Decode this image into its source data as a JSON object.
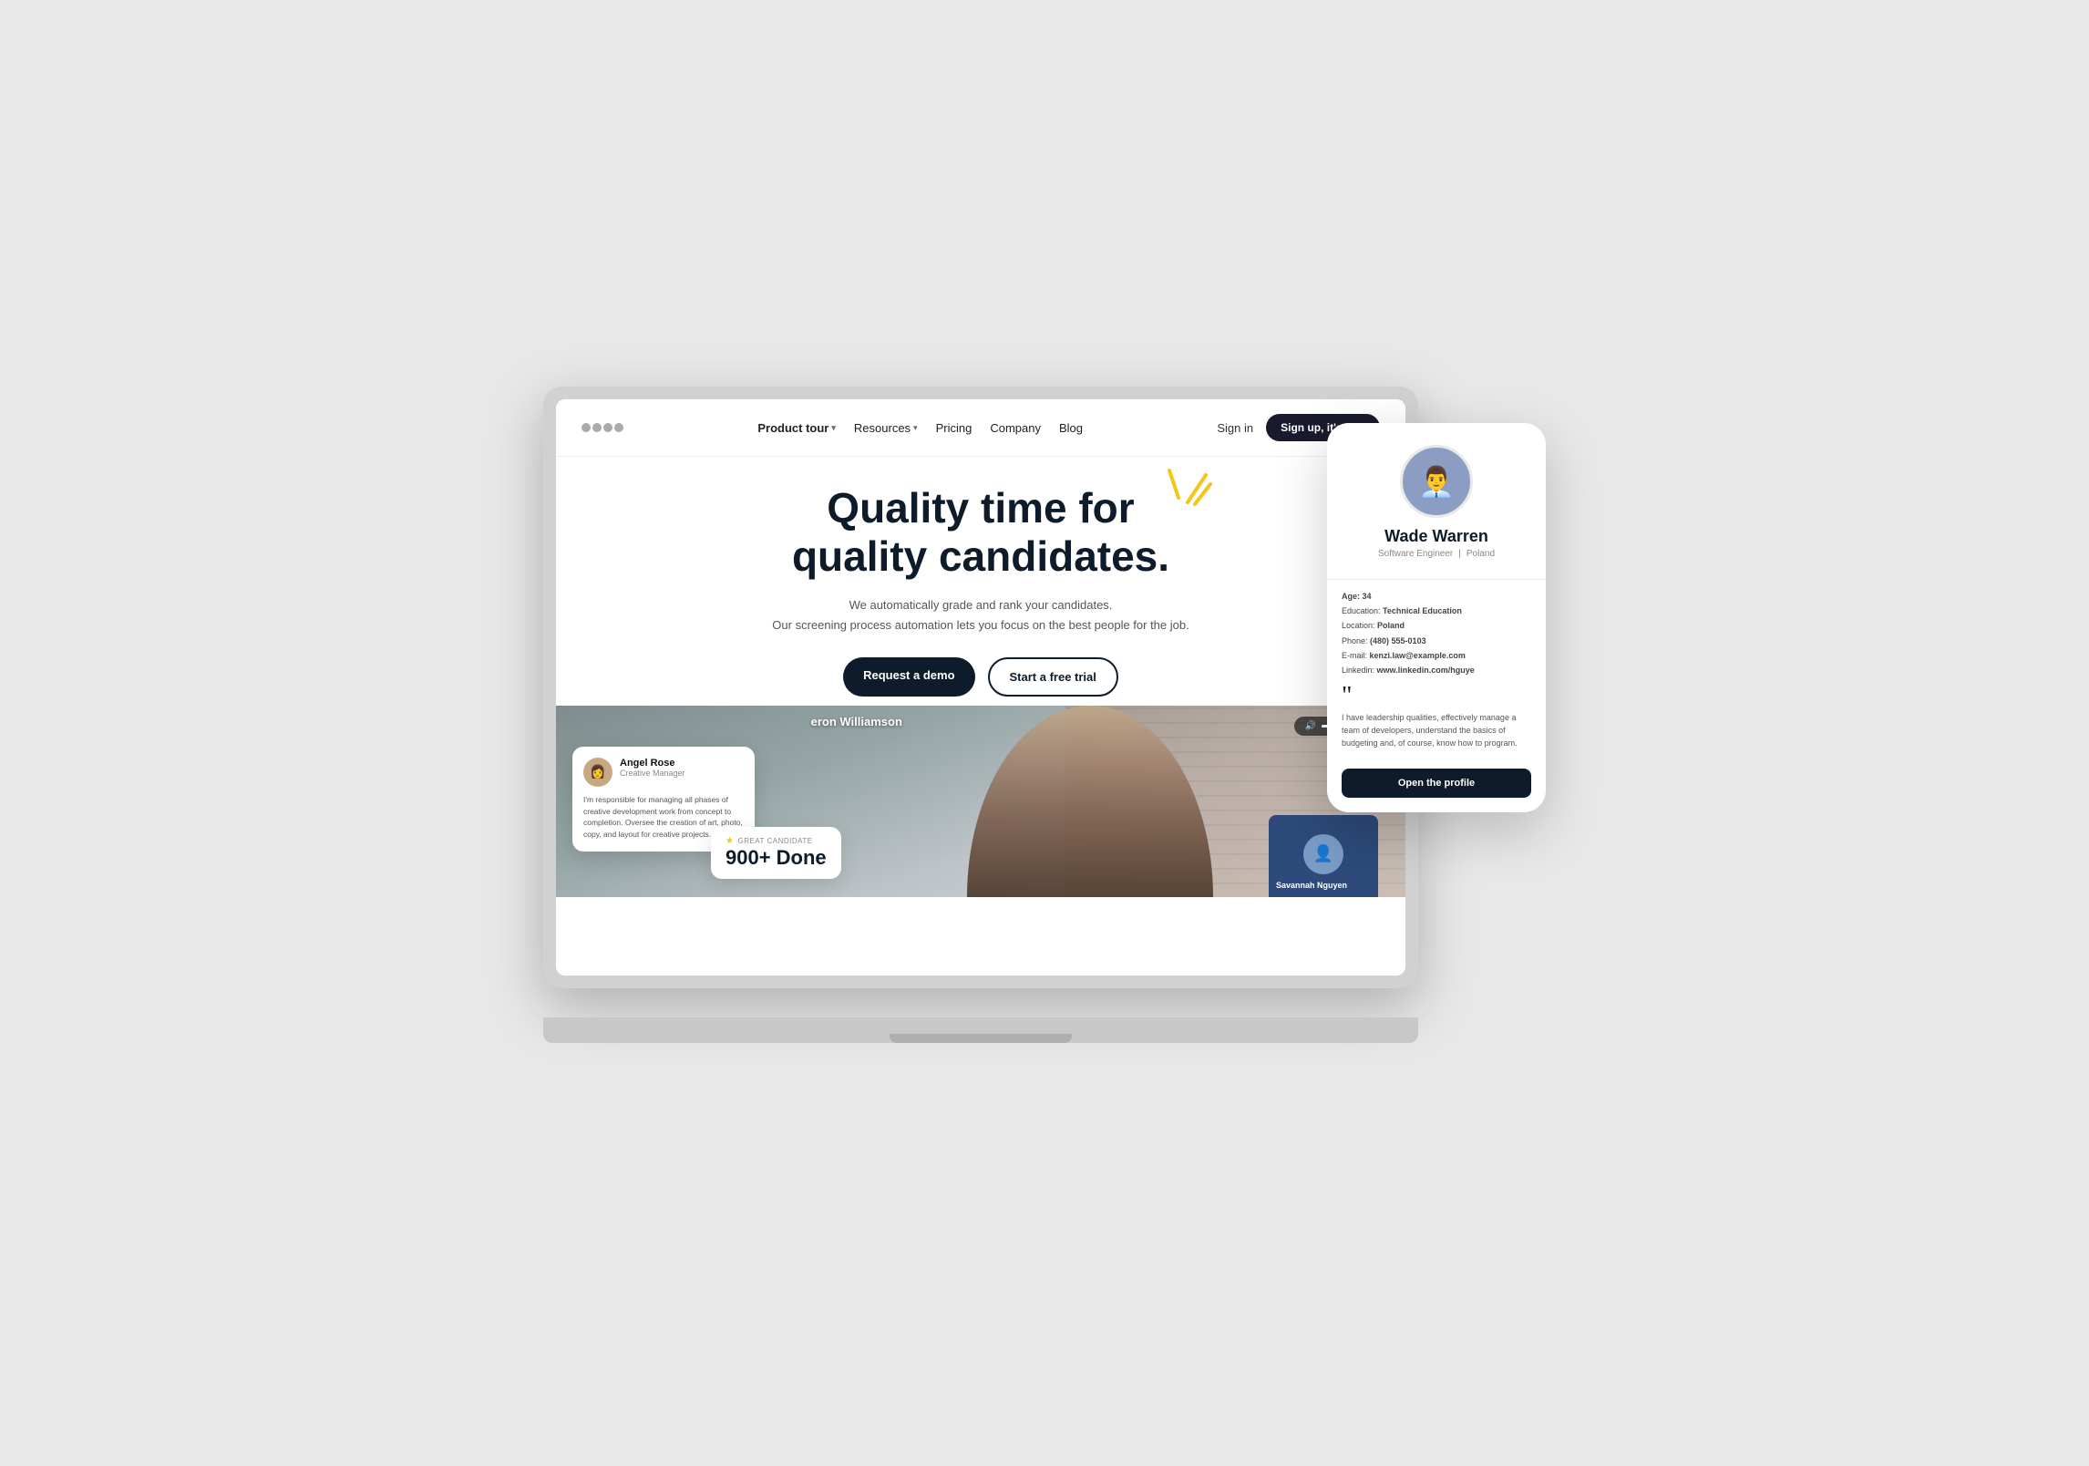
{
  "scene": {
    "background": "#e2e2e2"
  },
  "nav": {
    "logo_dots": 4,
    "links": [
      {
        "label": "Product tour",
        "hasChevron": true,
        "active": true
      },
      {
        "label": "Resources",
        "hasChevron": true,
        "active": false
      },
      {
        "label": "Pricing",
        "hasChevron": false,
        "active": false
      },
      {
        "label": "Company",
        "hasChevron": false,
        "active": false
      },
      {
        "label": "Blog",
        "hasChevron": false,
        "active": false
      }
    ],
    "sign_in": "Sign in",
    "sign_up": "Sign up, it's free"
  },
  "hero": {
    "title_line1": "Quality time for",
    "title_line2": "quality candidates.",
    "subtitle_line1": "We automatically grade and rank your candidates.",
    "subtitle_line2": "Our screening process automation lets you focus on the best people for the job.",
    "btn_demo": "Request a demo",
    "btn_trial": "Start a free trial"
  },
  "candidate_card": {
    "name": "Angel Rose",
    "role": "Creative Manager",
    "description": "I'm responsible for managing all phases of creative development work from concept to completion. Oversee the creation of art, photo, copy, and layout for creative projects."
  },
  "stats_badge": {
    "label": "GREAT CANDIDATE",
    "value": "900+ Done"
  },
  "video_call": {
    "caller_name": "eron Williamson",
    "volume_icon": "🔊"
  },
  "small_candidate": {
    "name": "Savannah Nguyen"
  },
  "phone": {
    "candidate": {
      "name": "Wade Warren",
      "role": "Software Engineer",
      "location": "Poland",
      "age_label": "Age:",
      "age": "34",
      "education_label": "Education:",
      "education": "Technical Education",
      "location_label": "Location:",
      "location_val": "Poland",
      "phone_label": "Phone:",
      "phone": "(480) 555-0103",
      "email_label": "E-mail:",
      "email": "kenzi.law@example.com",
      "linkedin_label": "Linkedin:",
      "linkedin": "www.linkedin.com/hguye",
      "quote": "I have leadership qualities, effectively manage a team of developers, understand the basics of budgeting and, of course, know how to program.",
      "open_btn": "Open the profile"
    }
  }
}
